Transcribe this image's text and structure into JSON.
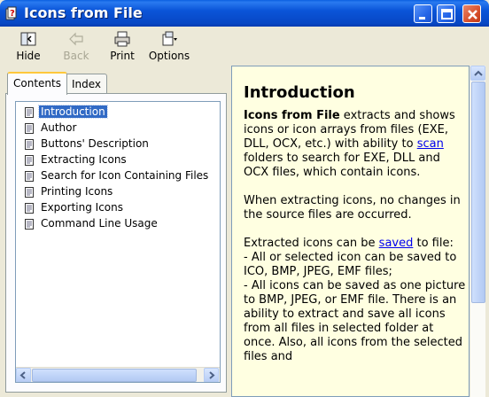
{
  "window": {
    "title": "Icons from File"
  },
  "toolbar": {
    "hide": "Hide",
    "back": "Back",
    "print": "Print",
    "options": "Options"
  },
  "tabs": {
    "contents": "Contents",
    "index": "Index"
  },
  "tree": {
    "items": [
      "Introduction",
      "Author",
      "Buttons' Description",
      "Extracting Icons",
      "Search for Icon Containing Files",
      "Printing Icons",
      "Exporting Icons",
      "Command Line Usage"
    ],
    "selected": "Introduction"
  },
  "article": {
    "heading": "Introduction",
    "p1_bold": "Icons from File",
    "p1_a": " extracts and shows icons or icon arrays from files (EXE, DLL, OCX, etc.) with ability to ",
    "p1_link": "scan",
    "p1_b": " folders to search for EXE, DLL and OCX files, which contain icons.",
    "p2": "When extracting icons, no changes in the source files are occurred.",
    "p3_a": "Extracted icons can be ",
    "p3_link": "saved",
    "p3_b": " to file:",
    "p3_line1": "- All or selected icon can be saved to ICO, BMP, JPEG, EMF files;",
    "p3_line2": "- All icons can be saved as one picture to BMP, JPEG, or EMF file. There is an ability to extract and save all icons from all files in selected folder at once. Also, all icons from the selected files and"
  },
  "colors": {
    "titlebar": "#0a54d8",
    "article_bg": "#ffffe1",
    "selection": "#316ac5",
    "link": "#0000ee"
  }
}
